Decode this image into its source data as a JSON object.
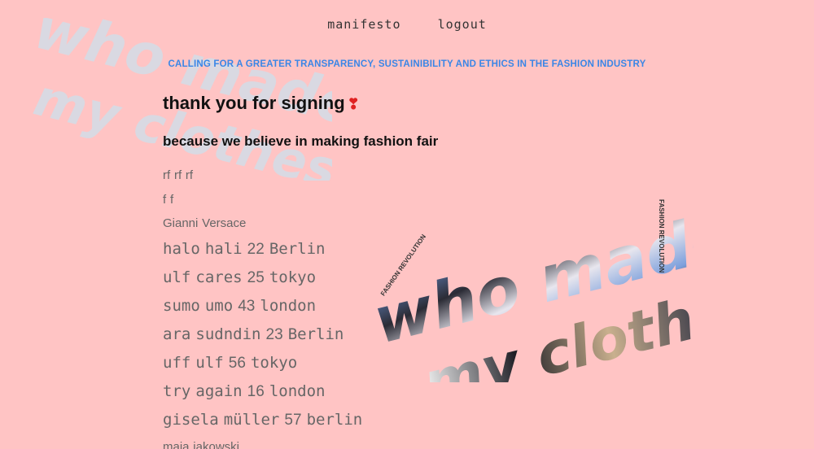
{
  "nav": {
    "manifesto": "manifesto",
    "logout": "logout"
  },
  "tagline": "CALLING FOR A GREATER TRANSPARENCY, SUSTAINIBILITY AND ETHICS IN THE FASHION INDUSTRY",
  "heading": {
    "thanks": "thank you for signing",
    "heart": "❣",
    "subheading": "because we believe in making fashion fair"
  },
  "signers": [
    {
      "first": "rf",
      "last": "rf",
      "age": "",
      "city": "rf"
    },
    {
      "first": "f",
      "last": "f",
      "age": "",
      "city": ""
    },
    {
      "first": "Gianni",
      "last": "Versace",
      "age": "",
      "city": ""
    },
    {
      "first": "halo",
      "last": "hali",
      "age": "22",
      "city": "Berlin"
    },
    {
      "first": "ulf",
      "last": "cares",
      "age": "25",
      "city": "tokyo"
    },
    {
      "first": "sumo",
      "last": "umo",
      "age": "43",
      "city": "london"
    },
    {
      "first": "ara",
      "last": "sudndin",
      "age": "23",
      "city": "Berlin"
    },
    {
      "first": "uff",
      "last": "ulf",
      "age": "56",
      "city": "tokyo"
    },
    {
      "first": "try",
      "last": "again",
      "age": "16",
      "city": "london"
    },
    {
      "first": "gisela",
      "last": "müller",
      "age": "57",
      "city": "berlin"
    },
    {
      "first": "maja",
      "last": "jakowski",
      "age": "",
      "city": ""
    }
  ],
  "logo": {
    "line1": "who made",
    "line2": "my clothes?",
    "badge": "FASHION REVOLUTION"
  }
}
